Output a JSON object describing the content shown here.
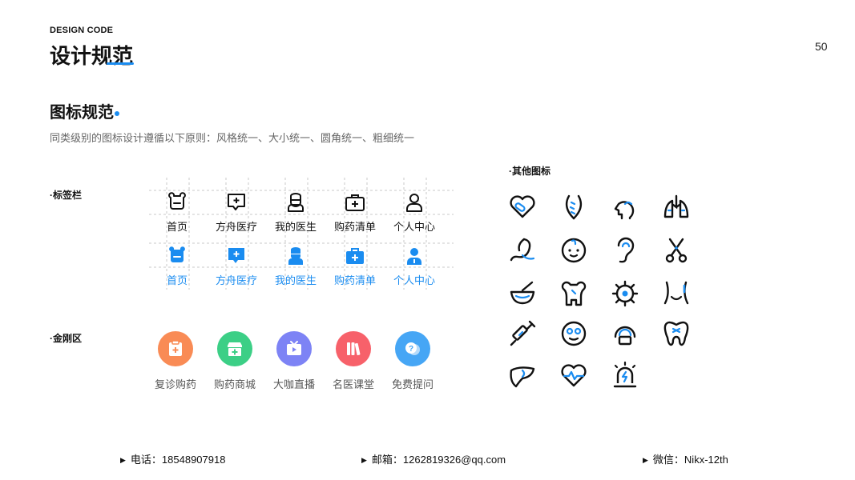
{
  "header": {
    "eyebrow": "DESIGN CODE",
    "title": "设计规范",
    "page_number": "50"
  },
  "section": {
    "title": "图标规范",
    "subtitle": "同类级别的图标设计遵循以下原则：风格统一、大小统一、圆角统一、粗细统一"
  },
  "tabbar": {
    "label": "·标签栏",
    "items": [
      {
        "label": "首页",
        "icon": "bear-face-icon"
      },
      {
        "label": "方舟医疗",
        "icon": "chat-plus-icon"
      },
      {
        "label": "我的医生",
        "icon": "doctor-icon"
      },
      {
        "label": "购药清单",
        "icon": "medicine-bag-icon"
      },
      {
        "label": "个人中心",
        "icon": "person-icon"
      }
    ],
    "active_color": "#1a8cf0"
  },
  "kingkong": {
    "label": "·金刚区",
    "items": [
      {
        "label": "复诊购药",
        "icon": "clipboard-plus-icon",
        "color": "#f98b55"
      },
      {
        "label": "购药商城",
        "icon": "shop-plus-icon",
        "color": "#3ccf86"
      },
      {
        "label": "大咖直播",
        "icon": "live-tv-icon",
        "color": "#7d83f5"
      },
      {
        "label": "名医课堂",
        "icon": "books-icon",
        "color": "#f7616a"
      },
      {
        "label": "免费提问",
        "icon": "question-chat-icon",
        "color": "#46a6f5"
      }
    ]
  },
  "other_icons": {
    "label": "·其他图标",
    "icons": [
      "broken-heart-bandage-icon",
      "spine-icon",
      "head-profile-icon",
      "lungs-icon",
      "stomach-icon",
      "baby-face-icon",
      "ear-icon",
      "scissors-icon",
      "mortar-pestle-icon",
      "bone-icon",
      "virus-icon",
      "body-waist-icon",
      "syringe-icon",
      "face-mask-icon",
      "head-scan-icon",
      "tooth-icon",
      "liver-icon",
      "heart-pulse-icon",
      "alarm-light-icon"
    ]
  },
  "footer": {
    "phone": "电话：18548907918",
    "email": "邮箱：1262819326@qq.com",
    "wechat": "微信：Nikx-12th"
  }
}
